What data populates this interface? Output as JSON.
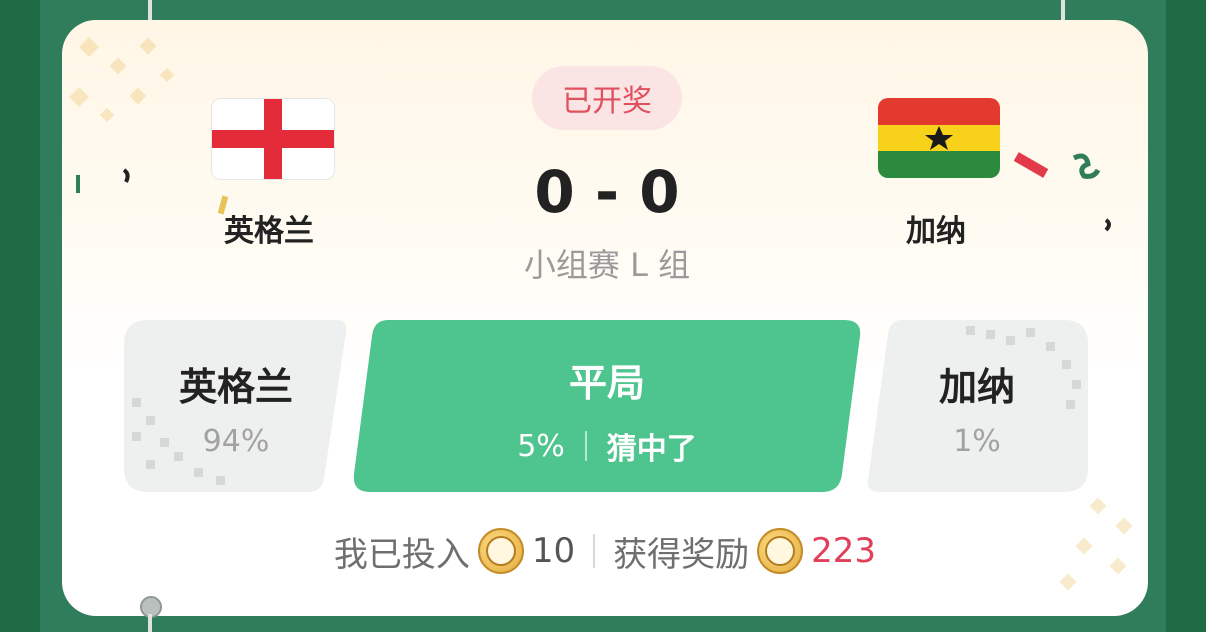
{
  "status_label": "已开奖",
  "home_team": {
    "name": "英格兰",
    "flag": "england-flag"
  },
  "away_team": {
    "name": "加纳",
    "flag": "ghana-flag"
  },
  "score": "0 - 0",
  "stage": "小组赛 L 组",
  "options": [
    {
      "name": "英格兰",
      "percent": "94%"
    },
    {
      "name": "平局",
      "percent": "5%",
      "result": "猜中了",
      "selected": true
    },
    {
      "name": "加纳",
      "percent": "1%"
    }
  ],
  "footer": {
    "invest_label": "我已投入",
    "invest_amount": "10",
    "reward_label": "获得奖励",
    "reward_amount": "223"
  },
  "colors": {
    "selected_green": "#4ec48f",
    "reward_red": "#e0405a",
    "status_red": "#e0505e"
  }
}
